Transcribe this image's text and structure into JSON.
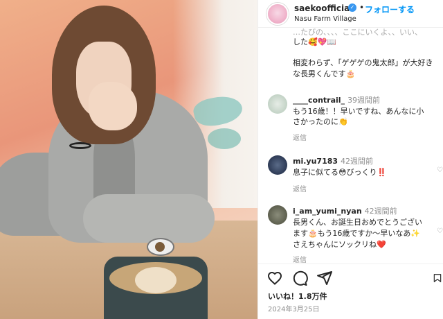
{
  "header": {
    "username": "saekoofficial",
    "follow_label": "フォローする",
    "location": "Nasu Farm Village"
  },
  "caption": {
    "line_top": "…たびの、、、、ここにいくよ、、いい、",
    "line_1": "した🥰💖📖",
    "line_2": "相変わらず、「ゲゲゲの鬼太郎」が大好き",
    "line_3": "な長男くんです🎂"
  },
  "comments": [
    {
      "user": "____contrail_",
      "time": "39週間前",
      "lines": [
        "もう16歳！！早いですね、あんなに小",
        "さかったのに👏"
      ],
      "reply": "返信"
    },
    {
      "user": "mi.yu7183",
      "time": "42週間前",
      "lines": [
        "息子に似てる😳びっくり‼️"
      ],
      "reply": "返信"
    },
    {
      "user": "i_am_yumi_nyan",
      "time": "42週間前",
      "lines": [
        "長男くん、お誕生日おめでとうござい",
        "ます🎂もう16歳ですか〜早いなあ✨",
        "さえちゃんにソックリね❤️"
      ],
      "reply": "返信"
    }
  ],
  "actions": {
    "likes": "いいね！1.8万件",
    "date": "2024年3月25日"
  },
  "colors": {
    "accent": "#0095f6",
    "verified": "#3897f0"
  },
  "icons": [
    "heart-icon",
    "comment-icon",
    "share-icon",
    "bookmark-icon",
    "verified-icon"
  ]
}
